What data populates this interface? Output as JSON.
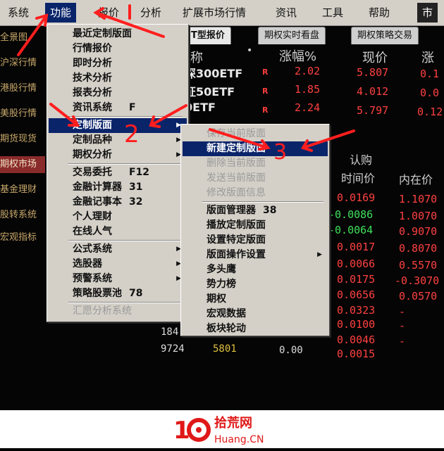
{
  "menubar": [
    "系统",
    "功能",
    "报价",
    "分析",
    "扩展市场行情",
    "资讯",
    "工具",
    "帮助",
    "市"
  ],
  "tabs": [
    "T型报价",
    "期权实时看盘",
    "期权策略交易"
  ],
  "left_items": [
    "全景图",
    "沪深行情",
    "港股行情",
    "美股行情",
    "期货现货",
    "期权市场",
    "基金理财",
    "股转系统",
    "宏观指标"
  ],
  "quote_header": {
    "name": "称",
    "change": "涨幅%",
    "price": "现价",
    "more": "涨"
  },
  "quotes": [
    {
      "sym": "深300ETF",
      "flag": "R",
      "chg": "2.02",
      "price": "5.807",
      "extra": "0.1"
    },
    {
      "sym": "证50ETF",
      "flag": "R",
      "chg": "1.85",
      "price": "4.012",
      "extra": "0.0"
    },
    {
      "sym": "0ETF",
      "flag": "R",
      "chg": "2.24",
      "price": "5.797",
      "extra": "0.12"
    }
  ],
  "right_panel": {
    "title": "认购",
    "headers": [
      "时间价",
      "内在价"
    ],
    "rows": [
      {
        "t": "0.0169",
        "n": "1.1070",
        "tc": "red"
      },
      {
        "t": "-0.0086",
        "n": "1.0070",
        "tc": "green"
      },
      {
        "t": "-0.0064",
        "n": "0.9070",
        "tc": "green"
      },
      {
        "t": "0.0017",
        "n": "0.8070",
        "tc": "red"
      },
      {
        "t": "0.0066",
        "n": "0.5570",
        "tc": "red"
      },
      {
        "t": "0.0175",
        "n": "-0.3070",
        "tc": "red"
      },
      {
        "t": "0.0656",
        "n": "0.0570",
        "tc": "red"
      },
      {
        "t": "0.0323",
        "n": "-",
        "tc": "red"
      },
      {
        "t": "0.0100",
        "n": "-",
        "tc": "red"
      },
      {
        "t": "0.0046",
        "n": "-",
        "tc": "red"
      },
      {
        "t": "0.0015",
        "n": "",
        "tc": "red"
      }
    ]
  },
  "bottom_row": {
    "a": "184",
    "b": "9724",
    "c": "5801",
    "d": "0.00"
  },
  "func_menu": [
    {
      "label": "最近定制版面"
    },
    {
      "label": "行情报价"
    },
    {
      "label": "即时分析"
    },
    {
      "label": "技术分析"
    },
    {
      "label": "报表分析"
    },
    {
      "label": "资讯系统",
      "key": "F"
    },
    {
      "sep": true
    },
    {
      "label": "定制版面",
      "arrow": true,
      "hl": true
    },
    {
      "label": "定制品种",
      "arrow": true
    },
    {
      "label": "期权分析",
      "arrow": true
    },
    {
      "sep": true
    },
    {
      "label": "交易委托",
      "key": "F12"
    },
    {
      "label": "金融计算器",
      "key": "31"
    },
    {
      "label": "金融记事本",
      "key": "32"
    },
    {
      "label": "个人理财"
    },
    {
      "label": "在线人气"
    },
    {
      "sep": true
    },
    {
      "label": "公式系统",
      "arrow": true
    },
    {
      "label": "选股器",
      "arrow": true
    },
    {
      "label": "预警系统",
      "arrow": true
    },
    {
      "label": "策略股票池",
      "key": "78"
    },
    {
      "sep": true
    },
    {
      "label": "汇愿分析系统",
      "disabled": true
    }
  ],
  "sub_menu": [
    {
      "label": "保存当前版面",
      "disabled": true
    },
    {
      "label": "新建定制版面",
      "hl": true
    },
    {
      "label": "删除当前版面",
      "disabled": true
    },
    {
      "label": "发送当前版面",
      "disabled": true
    },
    {
      "label": "修改版面信息",
      "disabled": true
    },
    {
      "sep": true
    },
    {
      "label": "版面管理器",
      "key": "38"
    },
    {
      "label": "播放定制版面"
    },
    {
      "label": "设置特定版面"
    },
    {
      "label": "版面操作设置",
      "arrow": true
    },
    {
      "label": "多头鹰"
    },
    {
      "label": "势力榜"
    },
    {
      "label": "期权"
    },
    {
      "label": "宏观数据"
    },
    {
      "label": "板块轮动"
    }
  ],
  "annotations": {
    "step2": "2",
    "step3": "3"
  },
  "watermark": {
    "main": "拾荒网",
    "sub": "Huang.CN"
  }
}
